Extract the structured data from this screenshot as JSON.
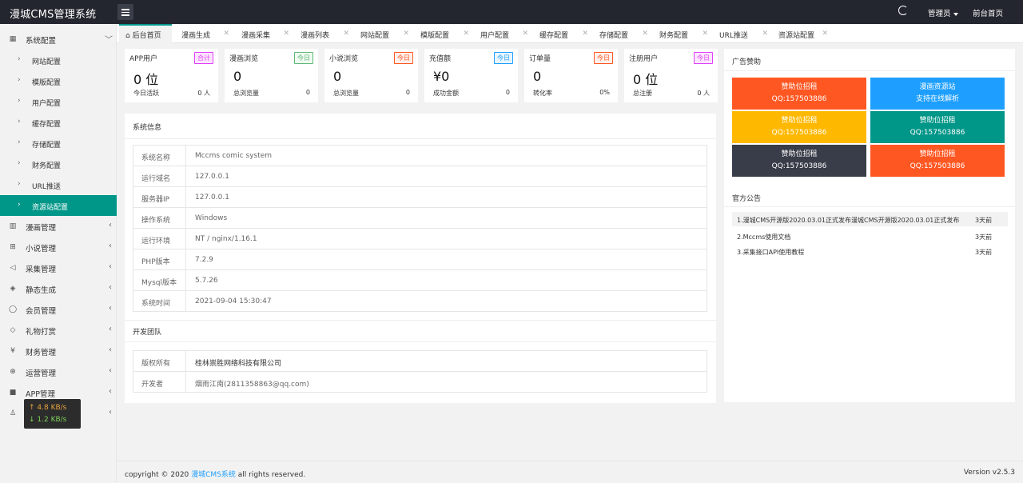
{
  "header": {
    "logo": "漫城CMS管理系统",
    "admin": "管理员",
    "frontpage": "前台首页"
  },
  "sidebar": {
    "system": "系统配置",
    "sub_items": [
      "网站配置",
      "模版配置",
      "用户配置",
      "缓存配置",
      "存储配置",
      "财务配置",
      "URL推送",
      "资源站配置"
    ],
    "menus": [
      {
        "label": "漫画管理",
        "icon": "book-icon"
      },
      {
        "label": "小说管理",
        "icon": "reader-icon"
      },
      {
        "label": "采集管理",
        "icon": "send-icon"
      },
      {
        "label": "静态生成",
        "icon": "layers-icon"
      },
      {
        "label": "会员管理",
        "icon": "user-icon"
      },
      {
        "label": "礼物打赏",
        "icon": "diamond-icon"
      },
      {
        "label": "财务管理",
        "icon": "money-icon"
      },
      {
        "label": "运营管理",
        "icon": "globe-icon"
      },
      {
        "label": "APP管理",
        "icon": "windows-icon"
      },
      {
        "label": "",
        "icon": "person-icon"
      }
    ]
  },
  "speed": {
    "up": "↑ 4.8 KB/s",
    "down": "↓ 1.2 KB/s"
  },
  "tabs": [
    "后台首页",
    "漫画生成",
    "漫画采集",
    "漫画列表",
    "网站配置",
    "模版配置",
    "用户配置",
    "缓存配置",
    "存储配置",
    "财务配置",
    "URL推送",
    "资源站配置"
  ],
  "stats": [
    {
      "title": "APP用户",
      "badge": "合计",
      "value": "0 位",
      "sub_label": "今日活跃",
      "sub_value": "0 人",
      "color": "#e040fb"
    },
    {
      "title": "漫画浏览",
      "badge": "今日",
      "value": "0",
      "sub_label": "总浏览量",
      "sub_value": "0",
      "color": "#5fb878"
    },
    {
      "title": "小说浏览",
      "badge": "今日",
      "value": "0",
      "sub_label": "总浏览量",
      "sub_value": "0",
      "color": "#ff5722"
    },
    {
      "title": "充值额",
      "badge": "今日",
      "value": "¥0",
      "sub_label": "成功金额",
      "sub_value": "0",
      "color": "#1e9fff"
    },
    {
      "title": "订单量",
      "badge": "今日",
      "value": "0",
      "sub_label": "转化率",
      "sub_value": "0%",
      "color": "#ff5722"
    },
    {
      "title": "注册用户",
      "badge": "今日",
      "value": "0 位",
      "sub_label": "总注册",
      "sub_value": "0 人",
      "color": "#e040fb"
    }
  ],
  "sysinfo": {
    "title": "系统信息",
    "rows": [
      {
        "k": "系统名称",
        "v": "Mccms comic system"
      },
      {
        "k": "运行域名",
        "v": "127.0.0.1"
      },
      {
        "k": "服务器IP",
        "v": "127.0.0.1"
      },
      {
        "k": "操作系统",
        "v": "Windows"
      },
      {
        "k": "运行环境",
        "v": "NT / nginx/1.16.1"
      },
      {
        "k": "PHP版本",
        "v": "7.2.9"
      },
      {
        "k": "Mysql版本",
        "v": "5.7.26"
      },
      {
        "k": "系统时间",
        "v": "2021-09-04 15:30:47"
      }
    ]
  },
  "team": {
    "title": "开发团队",
    "rows": [
      {
        "k": "版权所有",
        "v": "桂林崇胜网络科技有限公司"
      },
      {
        "k": "开发者",
        "v": "烟雨江南(2811358863@qq.com)"
      }
    ]
  },
  "ads": {
    "title": "广告赞助",
    "items": [
      {
        "l1": "赞助位招租",
        "l2": "QQ:157503886",
        "color": "#ff5722"
      },
      {
        "l1": "漫画资源站",
        "l2": "支持在线解析",
        "color": "#1e9fff"
      },
      {
        "l1": "赞助位招租",
        "l2": "QQ:157503886",
        "color": "#ffb800"
      },
      {
        "l1": "赞助位招租",
        "l2": "QQ:157503886",
        "color": "#009688"
      },
      {
        "l1": "赞助位招租",
        "l2": "QQ:157503886",
        "color": "#393d49"
      },
      {
        "l1": "赞助位招租",
        "l2": "QQ:157503886",
        "color": "#ff5722"
      }
    ]
  },
  "notices": {
    "title": "官方公告",
    "items": [
      {
        "t": "1.漫城CMS开源版2020.03.01正式发布漫城CMS开源版2020.03.01正式发布",
        "d": "3天前"
      },
      {
        "t": "2.Mccms使用文档",
        "d": "3天前"
      },
      {
        "t": "3.采集接口API使用教程",
        "d": "3天前"
      }
    ]
  },
  "footer": {
    "pre": "copyright © 2020 ",
    "link": "漫城CMS系统",
    "post": " all rights reserved.",
    "version": "Version v2.5.3"
  }
}
